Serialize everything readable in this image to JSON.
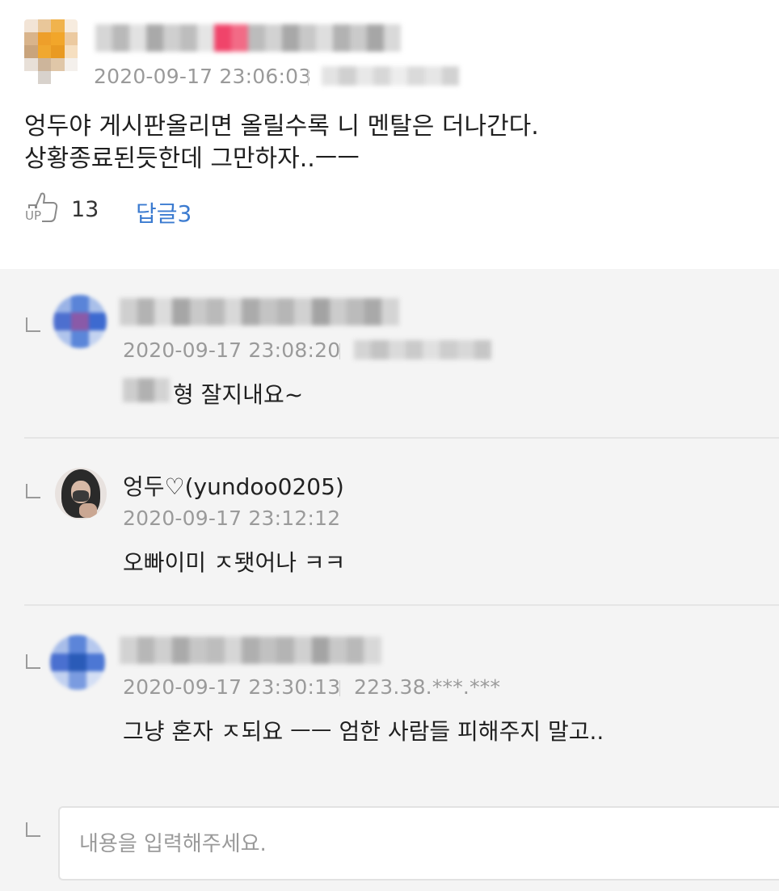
{
  "comment": {
    "timestamp": "2020-09-17 23:06:03",
    "text_line1": "엉두야 게시판올리면 올릴수록 니 멘탈은 더나간다.",
    "text_line2": "상황종료된듯한데 그만하자..ㅡㅡ",
    "up_label": "UP",
    "up_count": "13",
    "reply_link": "답글3"
  },
  "replies": [
    {
      "timestamp": "2020-09-17 23:08:20",
      "text": "형 잘지내요~"
    },
    {
      "author": "엉두♡(yundoo0205)",
      "timestamp": "2020-09-17 23:12:12",
      "text": "오빠이미 ㅈ됏어나 ㅋㅋ"
    },
    {
      "timestamp": "2020-09-17 23:30:13",
      "ip": "223.38.***.***",
      "text": "그냥 혼자 ㅈ되요 ㅡㅡ 엄한 사람들 피해주지 말고.."
    }
  ],
  "reply_input": {
    "placeholder": "내용을 입력해주세요."
  },
  "colors": {
    "link_blue": "#3b7bd0",
    "timestamp_gray": "#9a9a9a",
    "reply_background": "#f4f4f4"
  }
}
